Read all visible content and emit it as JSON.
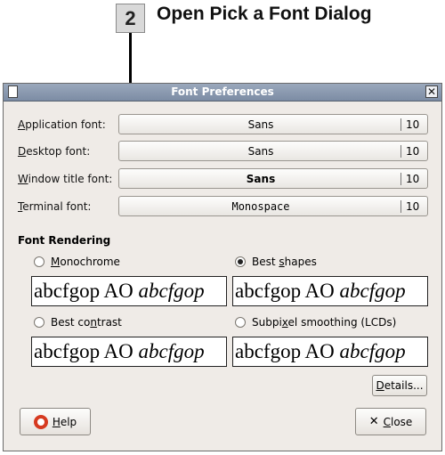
{
  "callout": {
    "number": "2",
    "text": "Open Pick a Font Dialog"
  },
  "window": {
    "title": "Font Preferences",
    "close_glyph": "✕"
  },
  "fonts": [
    {
      "label_u": "A",
      "label_rest": "pplication font:",
      "name": "Sans",
      "size": "10"
    },
    {
      "label_u": "D",
      "label_rest": "esktop font:",
      "name": "Sans",
      "size": "10"
    },
    {
      "label_u": "W",
      "label_rest": "indow title font:",
      "name": "Sans",
      "size": "10"
    },
    {
      "label_u": "T",
      "label_rest": "erminal font:",
      "name": "Monospace",
      "size": "10"
    }
  ],
  "rendering": {
    "heading": "Font Rendering",
    "options": [
      {
        "pre": "",
        "u": "M",
        "post": "onochrome",
        "checked": false
      },
      {
        "pre": "Best ",
        "u": "s",
        "post": "hapes",
        "checked": true
      },
      {
        "pre": "Best co",
        "u": "n",
        "post": "trast",
        "checked": false
      },
      {
        "pre": "Subpi",
        "u": "x",
        "post": "el smoothing (LCDs)",
        "checked": false
      }
    ],
    "sample_regular": "abcfgop AO ",
    "sample_italic": "abcfgop"
  },
  "buttons": {
    "details_u": "D",
    "details_rest": "etails...",
    "help_u": "H",
    "help_rest": "elp",
    "close_u": "C",
    "close_rest": "lose",
    "close_glyph": "✕"
  }
}
